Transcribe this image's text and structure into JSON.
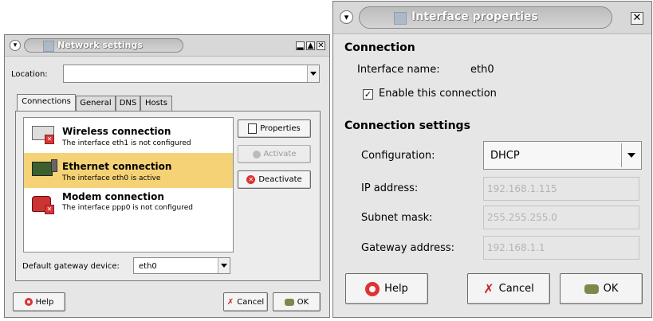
{
  "network_window": {
    "title": "Network settings",
    "location_label": "Location:",
    "location_value": "",
    "tabs": [
      {
        "label": "Connections"
      },
      {
        "label": "General"
      },
      {
        "label": "DNS"
      },
      {
        "label": "Hosts"
      }
    ],
    "connections": [
      {
        "title": "Wireless connection",
        "subtitle": "The interface eth1 is not configured",
        "selected": false
      },
      {
        "title": "Ethernet connection",
        "subtitle": "The interface eth0 is active",
        "selected": true
      },
      {
        "title": "Modem connection",
        "subtitle": "The interface ppp0 is not configured",
        "selected": false
      }
    ],
    "side_buttons": {
      "properties": "Properties",
      "activate": "Activate",
      "deactivate": "Deactivate"
    },
    "gateway_device_label": "Default gateway device:",
    "gateway_device_value": "eth0",
    "buttons": {
      "help": "Help",
      "cancel": "Cancel",
      "ok": "OK"
    }
  },
  "interface_window": {
    "title": "Interface properties",
    "connection_heading": "Connection",
    "interface_name_label": "Interface name:",
    "interface_name_value": "eth0",
    "enable_label": "Enable this connection",
    "enable_checked": true,
    "settings_heading": "Connection settings",
    "configuration_label": "Configuration:",
    "configuration_value": "DHCP",
    "ip_label": "IP address:",
    "ip_value": "192.168.1.115",
    "subnet_label": "Subnet mask:",
    "subnet_value": "255.255.255.0",
    "gateway_label": "Gateway address:",
    "gateway_value": "192.168.1.1",
    "buttons": {
      "help": "Help",
      "cancel": "Cancel",
      "ok": "OK"
    }
  },
  "colors": {
    "selection": "#f5d276",
    "window_bg": "#e6e6e6",
    "title_text": "#ffffff"
  }
}
